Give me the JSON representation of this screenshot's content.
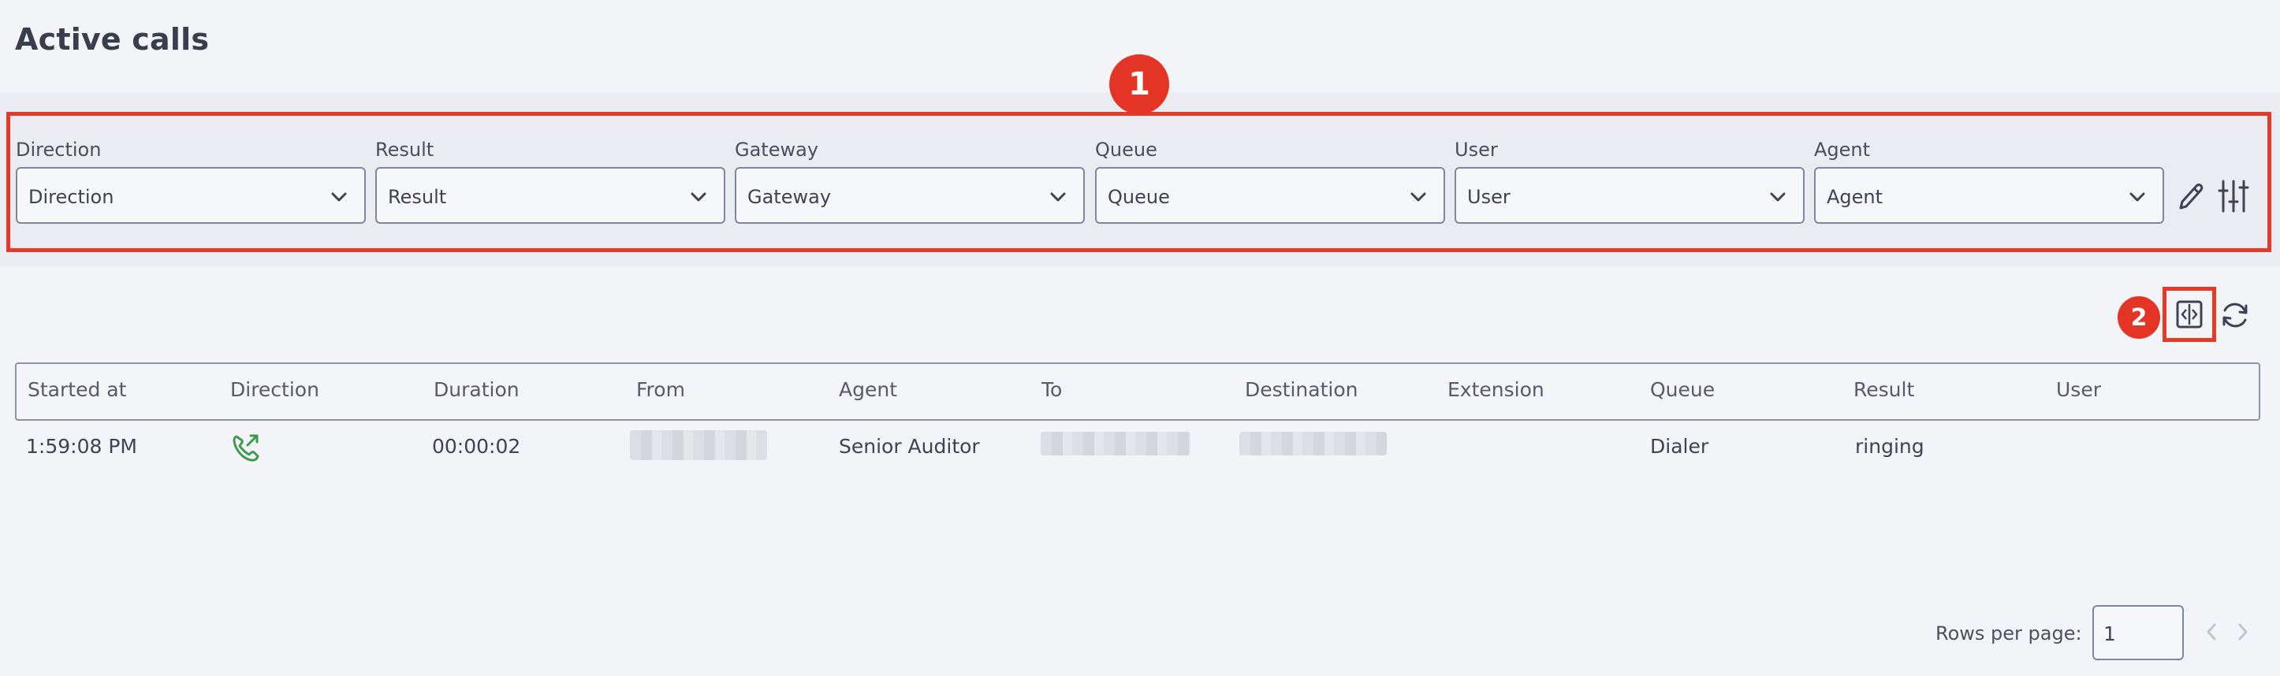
{
  "page": {
    "title": "Active calls"
  },
  "markers": {
    "m1": "1",
    "m2": "2"
  },
  "filters": [
    {
      "label": "Direction",
      "placeholder": "Direction"
    },
    {
      "label": "Result",
      "placeholder": "Result"
    },
    {
      "label": "Gateway",
      "placeholder": "Gateway"
    },
    {
      "label": "Queue",
      "placeholder": "Queue"
    },
    {
      "label": "User",
      "placeholder": "User"
    },
    {
      "label": "Agent",
      "placeholder": "Agent"
    }
  ],
  "icons": {
    "select_chevron": "chevron-down-icon",
    "edit": "pencil-icon",
    "filter_settings": "sliders-icon",
    "column_view": "expand-columns-icon",
    "refresh": "refresh-icon",
    "outgoing_call": "outgoing-call-icon"
  },
  "table": {
    "columns": [
      "Started at",
      "Direction",
      "Duration",
      "From",
      "Agent",
      "To",
      "Destination",
      "Extension",
      "Queue",
      "Result",
      "User"
    ],
    "rows": [
      {
        "started_at": "1:59:08 PM",
        "direction": "outgoing",
        "duration": "00:00:02",
        "agent": "Senior Auditor",
        "extension": "",
        "queue": "Dialer",
        "result": "ringing",
        "user": ""
      }
    ]
  },
  "pagination": {
    "rows_per_page_label": "Rows per page:",
    "rows_per_page_value": "1"
  },
  "colors": {
    "highlight": "#e53a2a",
    "call_icon": "#3f9a4f",
    "background": "#f3f4f8"
  }
}
